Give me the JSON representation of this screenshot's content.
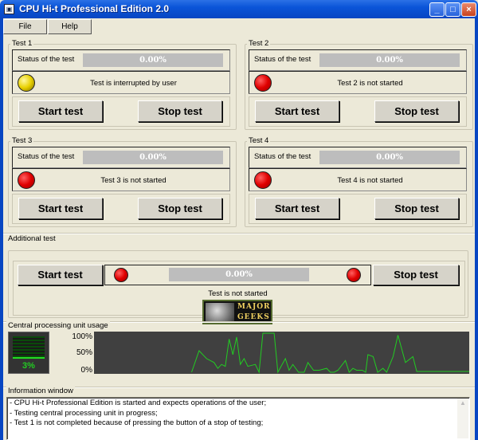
{
  "window": {
    "title": "CPU Hi-t Professional Edition 2.0",
    "icon": "app-icon",
    "controls": {
      "minimize": "_",
      "maximize": "□",
      "close": "×"
    }
  },
  "menu": {
    "file": "File",
    "help": "Help"
  },
  "tests": [
    {
      "title": "Test 1",
      "status_label": "Status of the test",
      "progress": "0.00%",
      "indicator": "yellow",
      "message": "Test is interrupted by user",
      "start": "Start test",
      "stop": "Stop test"
    },
    {
      "title": "Test 2",
      "status_label": "Status of the test",
      "progress": "0.00%",
      "indicator": "red",
      "message": "Test 2 is not started",
      "start": "Start test",
      "stop": "Stop test"
    },
    {
      "title": "Test 3",
      "status_label": "Status of the test",
      "progress": "0.00%",
      "indicator": "red",
      "message": "Test 3 is not started",
      "start": "Start test",
      "stop": "Stop test"
    },
    {
      "title": "Test 4",
      "status_label": "Status of the test",
      "progress": "0.00%",
      "indicator": "red",
      "message": "Test 4 is not started",
      "start": "Start test",
      "stop": "Stop test"
    }
  ],
  "additional": {
    "title": "Additional test",
    "start": "Start test",
    "stop": "Stop test",
    "progress": "0.00%",
    "message": "Test is not started",
    "logo": [
      "MAJOR",
      "GEEKS"
    ]
  },
  "cpu": {
    "title": "Central processing unit usage",
    "current": "3%",
    "current_value": 3,
    "y_labels": [
      "100%",
      "50%",
      "0%"
    ],
    "line_color": "#22cc22",
    "chart_data": {
      "type": "line",
      "ylim": [
        0,
        100
      ],
      "xlim": [
        0,
        100
      ],
      "x": [
        26,
        28,
        30,
        32,
        33,
        34,
        35,
        36,
        37,
        38,
        39,
        40,
        41,
        43,
        44,
        45,
        48,
        49,
        51,
        52,
        53,
        54.5,
        56,
        57,
        58.5,
        60,
        62,
        63,
        64,
        65,
        67,
        68,
        69,
        70,
        71.5,
        72.4,
        73,
        74.4,
        75.6,
        77,
        78,
        79.7,
        81,
        82,
        83,
        85,
        86,
        100
      ],
      "y": [
        0,
        55,
        35,
        25,
        10,
        20,
        15,
        85,
        45,
        90,
        20,
        35,
        15,
        20,
        0,
        100,
        100,
        0,
        35,
        5,
        20,
        0,
        0,
        25,
        5,
        5,
        10,
        0,
        0,
        5,
        30,
        0,
        10,
        5,
        5,
        0,
        45,
        40,
        0,
        10,
        0,
        40,
        95,
        60,
        25,
        40,
        2,
        2
      ]
    }
  },
  "info": {
    "title": "Information window",
    "lines": [
      "- CPU Hi-t Professional Edition is started and expects operations of the user;",
      "- Testing central processing unit in progress;",
      "- Test 1 is not completed because of pressing the button of a stop of testing;"
    ]
  }
}
